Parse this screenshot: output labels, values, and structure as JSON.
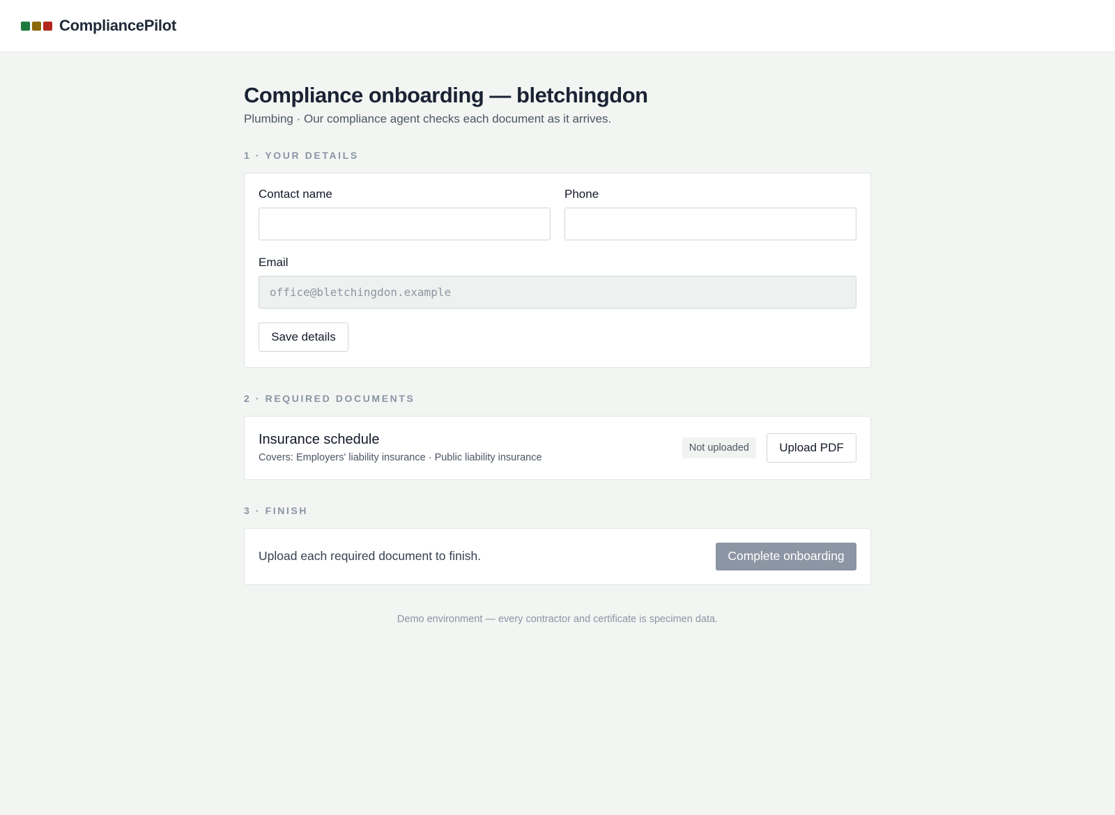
{
  "app": {
    "brand": "CompliancePilot",
    "logo_colors": [
      "#1e7a3c",
      "#8c6a0c",
      "#b3261e"
    ]
  },
  "page": {
    "title": "Compliance onboarding — bletchingdon",
    "subtitle": "Plumbing · Our compliance agent checks each document as it arrives."
  },
  "sections": {
    "details": {
      "heading": "1 · YOUR DETAILS",
      "contact_label": "Contact name",
      "contact_value": "",
      "phone_label": "Phone",
      "phone_value": "",
      "email_label": "Email",
      "email_value": "office@bletchingdon.example",
      "save_label": "Save details"
    },
    "documents": {
      "heading": "2 · REQUIRED DOCUMENTS",
      "items": [
        {
          "name": "Insurance schedule",
          "covers": "Covers: Employers' liability insurance · Public liability insurance",
          "status": "Not uploaded",
          "action_label": "Upload PDF"
        }
      ]
    },
    "finish": {
      "heading": "3 · FINISH",
      "message": "Upload each required document to finish.",
      "button_label": "Complete onboarding"
    }
  },
  "footer": {
    "note": "Demo environment — every contractor and certificate is specimen data."
  }
}
